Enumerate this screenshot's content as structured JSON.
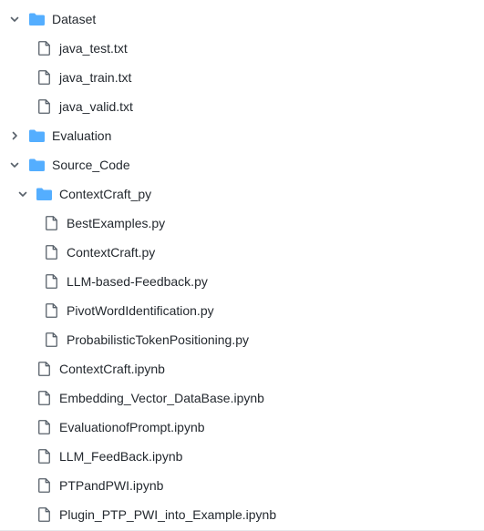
{
  "tree": {
    "dataset": {
      "label": "Dataset",
      "files": [
        "java_test.txt",
        "java_train.txt",
        "java_valid.txt"
      ]
    },
    "evaluation": {
      "label": "Evaluation"
    },
    "source_code": {
      "label": "Source_Code",
      "contextcraft_py": {
        "label": "ContextCraft_py",
        "files": [
          "BestExamples.py",
          "ContextCraft.py",
          "LLM-based-Feedback.py",
          "PivotWordIdentification.py",
          "ProbabilisticTokenPositioning.py"
        ]
      },
      "files": [
        "ContextCraft.ipynb",
        "Embedding_Vector_DataBase.ipynb",
        "EvaluationofPrompt.ipynb",
        "LLM_FeedBack.ipynb",
        "PTPandPWI.ipynb",
        "Plugin_PTP_PWI_into_Example.ipynb"
      ]
    }
  },
  "colors": {
    "folder": "#54aeff",
    "file_outline": "#57606a",
    "chevron": "#57606a",
    "text": "#24292f"
  },
  "icons": {
    "folder": "folder-icon",
    "file": "file-icon",
    "expanded": "chevron-down-icon",
    "collapsed": "chevron-right-icon"
  }
}
